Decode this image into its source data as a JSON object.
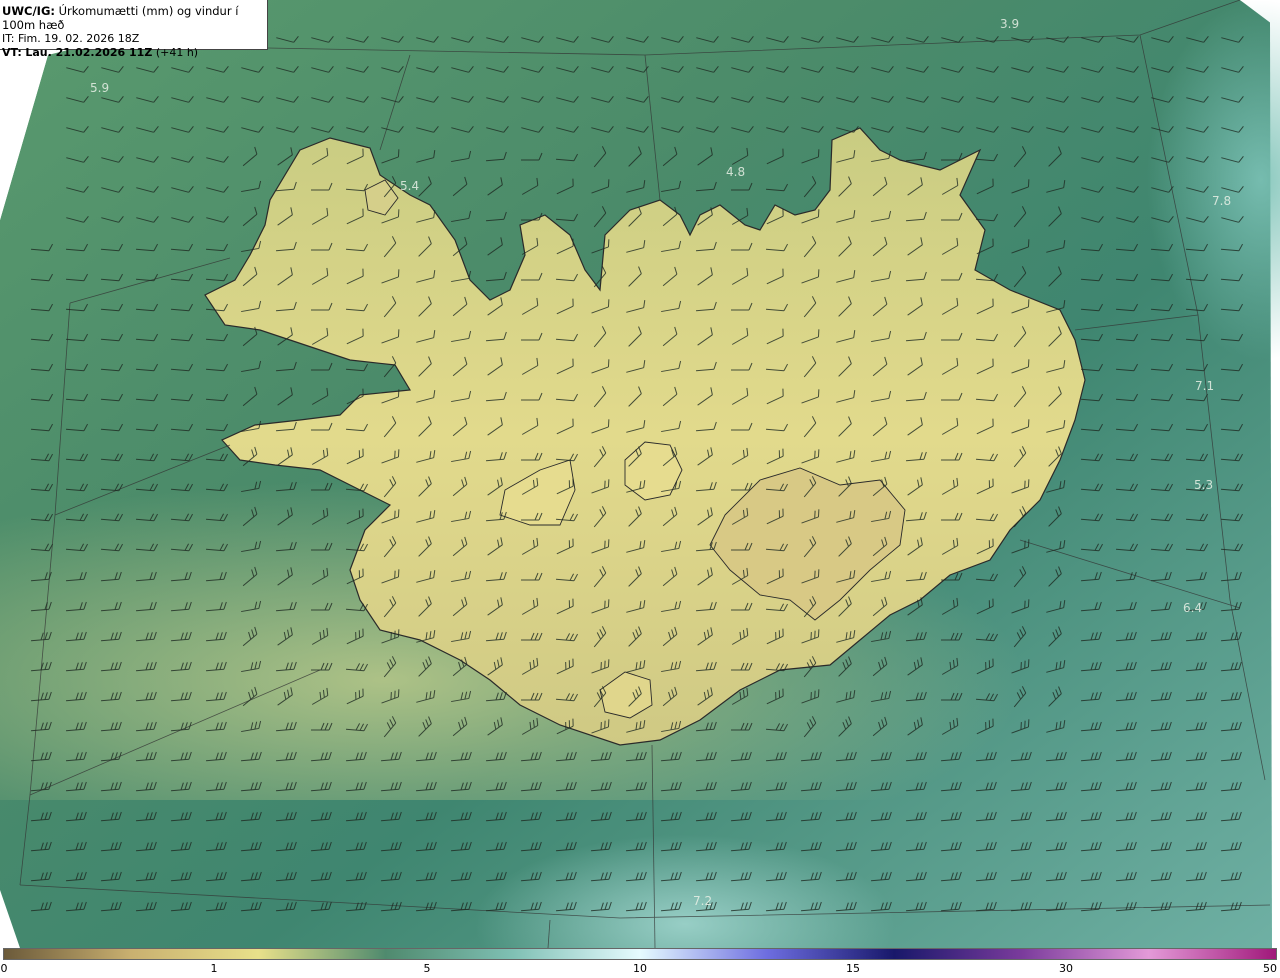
{
  "header": {
    "model": "UWC/IG:",
    "field_title": "Úrkomumætti (mm) og vindur í 100m hæð",
    "init_label": "IT:",
    "init_time": "Fim. 19. 02. 2026 18Z",
    "valid_label": "VT:",
    "valid_time": "Lau. 21.02.2026 11Z",
    "lead": "(+41 h)"
  },
  "map_labels": [
    {
      "text": "3.9"
    },
    {
      "text": "5.9"
    },
    {
      "text": "5.4"
    },
    {
      "text": "4.8"
    },
    {
      "text": "7.8"
    },
    {
      "text": "7.1"
    },
    {
      "text": "5.3"
    },
    {
      "text": "6.4"
    },
    {
      "text": "7.2"
    }
  ],
  "colorbar": {
    "ticks": [
      "0",
      "1",
      "5",
      "10",
      "15",
      "30",
      "50"
    ],
    "colors": [
      "#6b5a3a",
      "#c9b070",
      "#e8e08a",
      "#4f8a6e",
      "#7fc0b4",
      "#e6fbff",
      "#6d6de0",
      "#18186a",
      "#7a3b9c",
      "#e39ad8",
      "#a0187a"
    ]
  },
  "colors": {
    "land": "#d8d48a",
    "sea": "#4c8c70"
  }
}
